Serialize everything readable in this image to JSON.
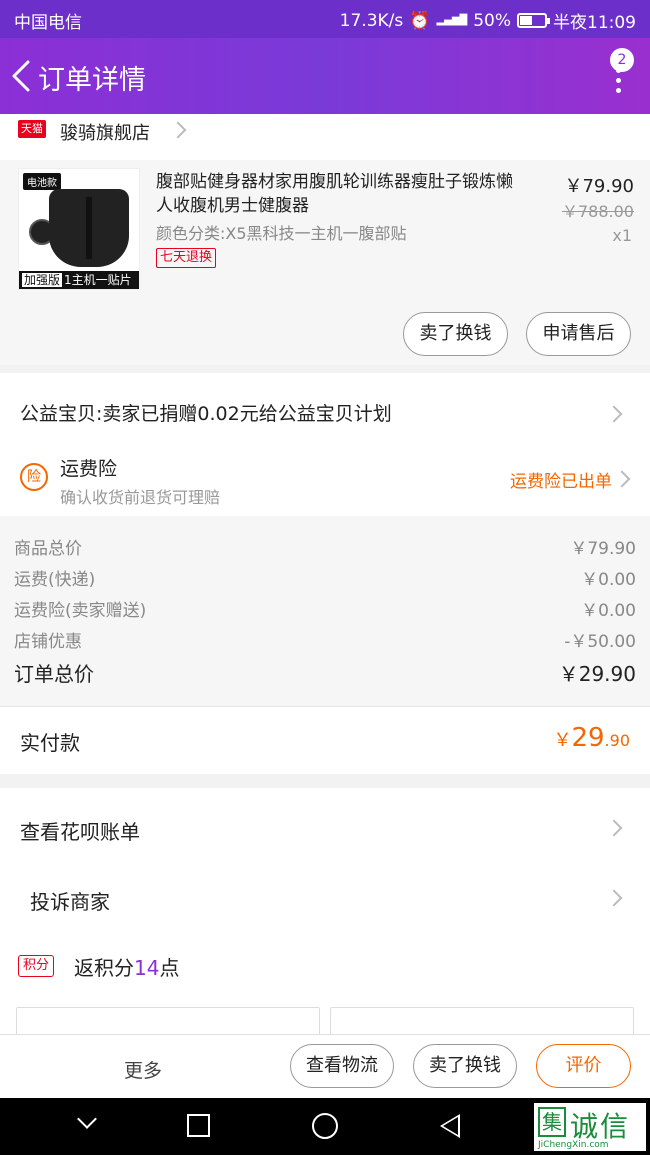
{
  "status_bar": {
    "carrier": "中国电信",
    "speed": "17.3K/s",
    "network": "4G 2G",
    "battery_percent": "50%",
    "battery_level": 0.5,
    "time": "半夜11:09"
  },
  "header": {
    "title": "订单详情",
    "badge_count": "2"
  },
  "shop": {
    "badge": "天猫",
    "name": "骏骑旗舰店"
  },
  "product": {
    "image_tag": "电池款",
    "image_banner_tag": "加强版",
    "image_banner_text": "1主机一贴片",
    "title": "腹部贴健身器材家用腹肌轮训练器瘦肚子锻炼懒人收腹机男士健腹器",
    "variant": "颜色分类:X5黑科技一主机一腹部贴",
    "return_badge": "七天退换",
    "price": "￥79.90",
    "original_price": "￥788.00",
    "quantity": "x1",
    "sell_button": "卖了换钱",
    "aftersale_button": "申请售后"
  },
  "charity": {
    "text": "公益宝贝:卖家已捐赠0.02元给公益宝贝计划"
  },
  "insurance": {
    "icon_label": "险",
    "title": "运费险",
    "subtitle": "确认收货前退货可理赔",
    "status": "运费险已出单"
  },
  "totals": [
    {
      "label": "商品总价",
      "value": "￥79.90"
    },
    {
      "label": "运费(快递)",
      "value": "￥0.00"
    },
    {
      "label": "运费险(卖家赠送)",
      "value": "￥0.00"
    },
    {
      "label": "店铺优惠",
      "value": "-￥50.00"
    }
  ],
  "order_total": {
    "label": "订单总价",
    "value": "￥29.90"
  },
  "paid": {
    "label": "实付款",
    "currency": "￥",
    "integer": "29",
    "decimal": ".90"
  },
  "links": {
    "huabei": "查看花呗账单",
    "complaint": "投诉商家",
    "points_badge": "积分",
    "points_prefix": "返积分",
    "points_value": "14",
    "points_suffix": "点"
  },
  "action_bar": {
    "more": "更多",
    "logistics": "查看物流",
    "sell": "卖了换钱",
    "review": "评价"
  },
  "watermark": {
    "box_char": "集",
    "brand": "诚信",
    "domain": "JiChengXin.com"
  },
  "colors": {
    "header_purple": "#7a3ad8",
    "accent_orange": "#f56600",
    "tmall_red": "#e8001d",
    "watermark_green": "#1b8c3a"
  }
}
